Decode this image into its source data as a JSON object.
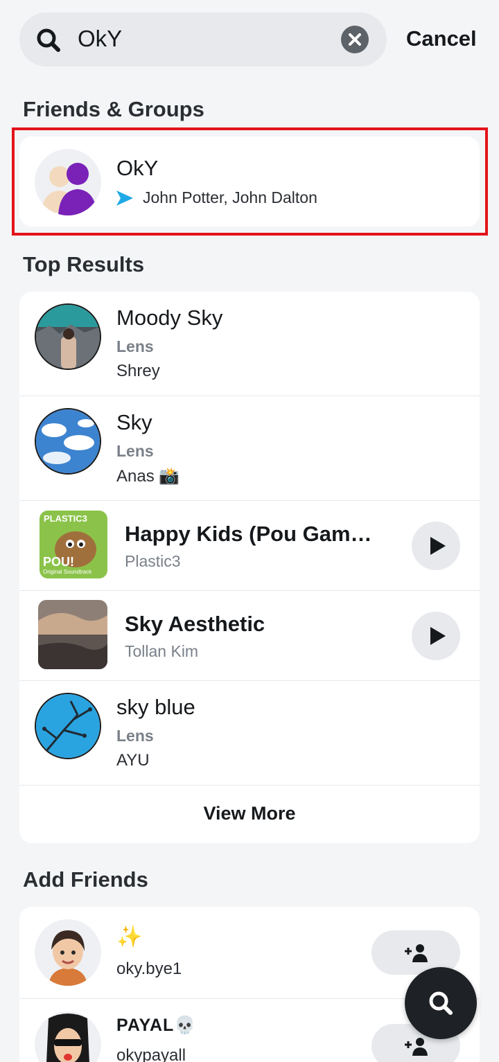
{
  "search": {
    "query": "OkY",
    "cancel_label": "Cancel"
  },
  "friends_groups": {
    "title": "Friends & Groups",
    "group": {
      "name": "OkY",
      "members": "John Potter, John Dalton"
    }
  },
  "top_results": {
    "title": "Top Results",
    "items": [
      {
        "name": "Moody Sky",
        "type": "Lens",
        "author": "Shrey"
      },
      {
        "name": "Sky",
        "type": "Lens",
        "author": "Anas 📸"
      },
      {
        "name": "Happy Kids (Pou Gam…",
        "artist": "Plastic3",
        "thumb_label": "PLASTIC3",
        "thumb_logo": "POU!",
        "thumb_caption": "Original Soundtrack"
      },
      {
        "name": "Sky Aesthetic",
        "artist": "Tollan Kim"
      },
      {
        "name": "sky blue",
        "type": "Lens",
        "author": "AYU"
      }
    ],
    "view_more_label": "View More"
  },
  "add_friends": {
    "title": "Add Friends",
    "items": [
      {
        "display_name": "✨",
        "username": "oky.bye1"
      },
      {
        "display_name": "PAYAL💀",
        "username": "okypayall"
      }
    ]
  },
  "colors": {
    "highlight": "#e4131b",
    "send_arrow": "#1fa9e6",
    "purple_avatar": "#7a22b8"
  }
}
